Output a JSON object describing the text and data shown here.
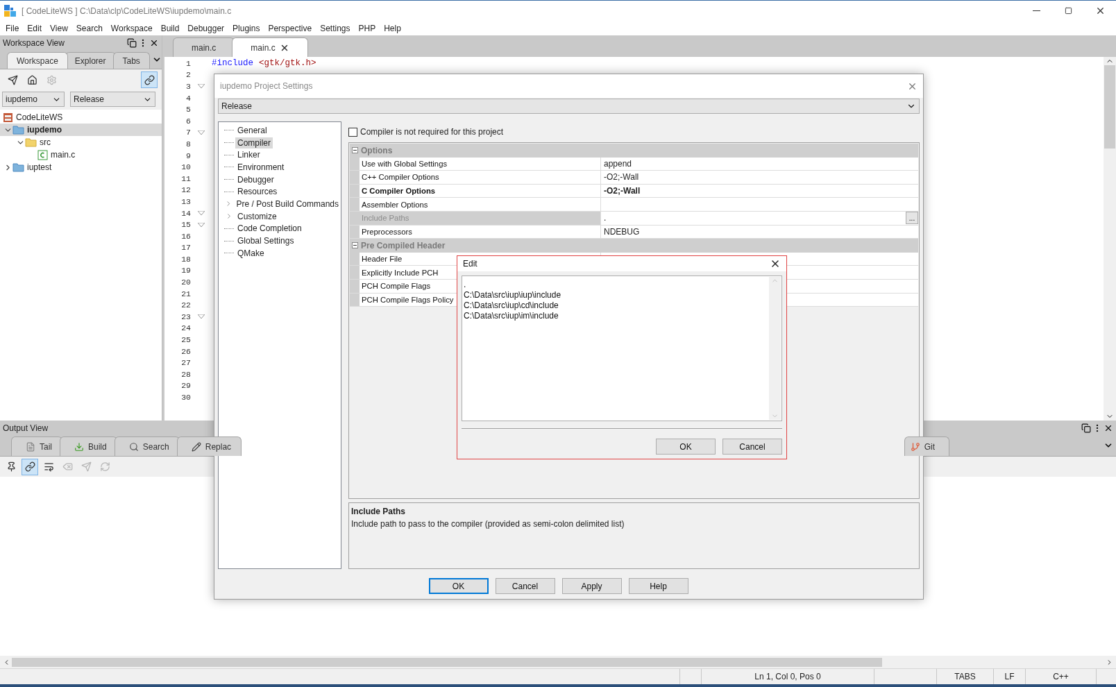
{
  "window": {
    "title": "[ CodeLiteWS ] C:\\Data\\clp\\CodeLiteWS\\iupdemo\\main.c"
  },
  "menu": [
    "File",
    "Edit",
    "View",
    "Search",
    "Workspace",
    "Build",
    "Debugger",
    "Plugins",
    "Perspective",
    "Settings",
    "PHP",
    "Help"
  ],
  "workspace_view": {
    "title": "Workspace View",
    "tabs": [
      {
        "label": "Workspace",
        "selected": true
      },
      {
        "label": "Explorer",
        "selected": false
      },
      {
        "label": "Tabs",
        "selected": false
      }
    ],
    "toolbar": [
      {
        "kind": "send",
        "active": false,
        "disabled": false
      },
      {
        "kind": "home",
        "active": false,
        "disabled": false
      },
      {
        "kind": "settings",
        "active": false,
        "disabled": true
      },
      {
        "kind": "link",
        "active": true,
        "disabled": false
      }
    ],
    "project_select": "iupdemo",
    "config_select": "Release",
    "tree": [
      {
        "label": "CodeLiteWS",
        "kind": "workspace",
        "selected": false,
        "expanded": true,
        "children": [
          {
            "label": "iupdemo",
            "kind": "project",
            "selected": true,
            "expanded": true,
            "children": [
              {
                "label": "src",
                "kind": "folder",
                "selected": false,
                "expanded": true,
                "children": [
                  {
                    "label": "main.c",
                    "kind": "file",
                    "selected": false
                  }
                ]
              }
            ]
          },
          {
            "label": "iuptest",
            "kind": "project",
            "selected": false,
            "expanded": false
          }
        ]
      }
    ]
  },
  "editor": {
    "tabs": [
      {
        "label": "main.c",
        "selected": false
      },
      {
        "label": "main.c",
        "selected": true
      }
    ],
    "lines": [
      {
        "number": "1",
        "fold": false,
        "code": [
          {
            "kind": "keyword",
            "text": "#include"
          },
          {
            "kind": "string",
            "text": "<gtk/gtk.h>"
          }
        ]
      },
      {
        "number": "2",
        "fold": false
      },
      {
        "number": "3",
        "fold": true
      },
      {
        "number": "4",
        "fold": false
      },
      {
        "number": "5",
        "fold": false
      },
      {
        "number": "6",
        "fold": false
      },
      {
        "number": "7",
        "fold": true
      },
      {
        "number": "8",
        "fold": false
      },
      {
        "number": "9",
        "fold": false
      },
      {
        "number": "10",
        "fold": false
      },
      {
        "number": "11",
        "fold": false
      },
      {
        "number": "12",
        "fold": false
      },
      {
        "number": "13",
        "fold": false
      },
      {
        "number": "14",
        "fold": true
      },
      {
        "number": "15",
        "fold": true
      },
      {
        "number": "16",
        "fold": false
      },
      {
        "number": "17",
        "fold": false
      },
      {
        "number": "18",
        "fold": false
      },
      {
        "number": "19",
        "fold": false
      },
      {
        "number": "20",
        "fold": false
      },
      {
        "number": "21",
        "fold": false
      },
      {
        "number": "22",
        "fold": false
      },
      {
        "number": "23",
        "fold": true
      },
      {
        "number": "24",
        "fold": false
      },
      {
        "number": "25",
        "fold": false
      },
      {
        "number": "26",
        "fold": false
      },
      {
        "number": "27",
        "fold": false
      },
      {
        "number": "28",
        "fold": false
      },
      {
        "number": "29",
        "fold": false
      },
      {
        "number": "30",
        "fold": false
      }
    ]
  },
  "output_view": {
    "title": "Output View",
    "tabs": [
      {
        "label": "Tail",
        "kind": "tail",
        "selected": false
      },
      {
        "label": "Build",
        "kind": "build",
        "selected": false
      },
      {
        "label": "Search",
        "kind": "search",
        "selected": false
      },
      {
        "label": "Replac",
        "kind": "replace",
        "selected": false
      }
    ],
    "right_tabs": [
      {
        "label": "Git",
        "kind": "git",
        "selected": false
      }
    ],
    "toolbar": [
      {
        "kind": "pin",
        "active": false,
        "disabled": false
      },
      {
        "kind": "link",
        "active": true,
        "disabled": false
      },
      {
        "kind": "wrap",
        "active": false,
        "disabled": false
      },
      {
        "kind": "clear",
        "active": false,
        "disabled": true
      },
      {
        "kind": "send",
        "active": false,
        "disabled": true
      },
      {
        "kind": "refresh",
        "active": false,
        "disabled": true
      }
    ]
  },
  "status_bar": {
    "cells": [
      "",
      "Ln 1, Col 0, Pos 0",
      "",
      "TABS",
      "LF",
      "C++"
    ]
  },
  "project_settings": {
    "title": "iupdemo Project Settings",
    "config": "Release",
    "nav": [
      {
        "label": "General",
        "selected": false,
        "expandable": false
      },
      {
        "label": "Compiler",
        "selected": true,
        "expandable": false
      },
      {
        "label": "Linker",
        "selected": false,
        "expandable": false
      },
      {
        "label": "Environment",
        "selected": false,
        "expandable": false
      },
      {
        "label": "Debugger",
        "selected": false,
        "expandable": false
      },
      {
        "label": "Resources",
        "selected": false,
        "expandable": false
      },
      {
        "label": "Pre / Post Build Commands",
        "selected": false,
        "expandable": true
      },
      {
        "label": "Customize",
        "selected": false,
        "expandable": true
      },
      {
        "label": "Code Completion",
        "selected": false,
        "expandable": false
      },
      {
        "label": "Global Settings",
        "selected": false,
        "expandable": false
      },
      {
        "label": "QMake",
        "selected": false,
        "expandable": false
      }
    ],
    "checkbox": {
      "label": "Compiler is not required for this project",
      "checked": false
    },
    "sections": [
      {
        "title": "Options",
        "expanded": true,
        "rows": [
          {
            "label": "Use with Global Settings",
            "value": "append",
            "selected": false,
            "modified": false
          },
          {
            "label": "C++ Compiler Options",
            "value": "-O2;-Wall",
            "selected": false,
            "modified": false
          },
          {
            "label": "C Compiler Options",
            "value": "-O2;-Wall",
            "selected": false,
            "modified": true
          },
          {
            "label": "Assembler Options",
            "selected": false,
            "modified": false
          },
          {
            "label": "Include Paths",
            "value": ".",
            "selected": true,
            "modified": false,
            "button": "..."
          },
          {
            "label": "Preprocessors",
            "value": "NDEBUG",
            "selected": false,
            "modified": false
          }
        ]
      },
      {
        "title": "Pre Compiled Header",
        "expanded": true,
        "rows": [
          {
            "label": "Header File",
            "selected": false,
            "modified": false
          },
          {
            "label": "Explicitly Include PCH",
            "selected": false,
            "modified": false
          },
          {
            "label": "PCH Compile Flags",
            "selected": false,
            "modified": false
          },
          {
            "label": "PCH Compile Flags Policy",
            "selected": false,
            "modified": false
          }
        ]
      }
    ],
    "description": {
      "title": "Include Paths",
      "text": "Include path to pass to the compiler (provided as semi-colon delimited list)"
    },
    "buttons": [
      {
        "label": "OK",
        "default": true
      },
      {
        "label": "Cancel",
        "default": false
      },
      {
        "label": "Apply",
        "default": false
      },
      {
        "label": "Help",
        "default": false
      }
    ]
  },
  "edit_dialog": {
    "title": "Edit",
    "lines": [
      ".",
      "C:\\Data\\src\\iup\\iup\\include",
      "C:\\Data\\src\\iup\\cd\\include",
      "C:\\Data\\src\\iup\\im\\include"
    ],
    "buttons": [
      {
        "label": "OK",
        "default": false
      },
      {
        "label": "Cancel",
        "default": false
      }
    ]
  }
}
